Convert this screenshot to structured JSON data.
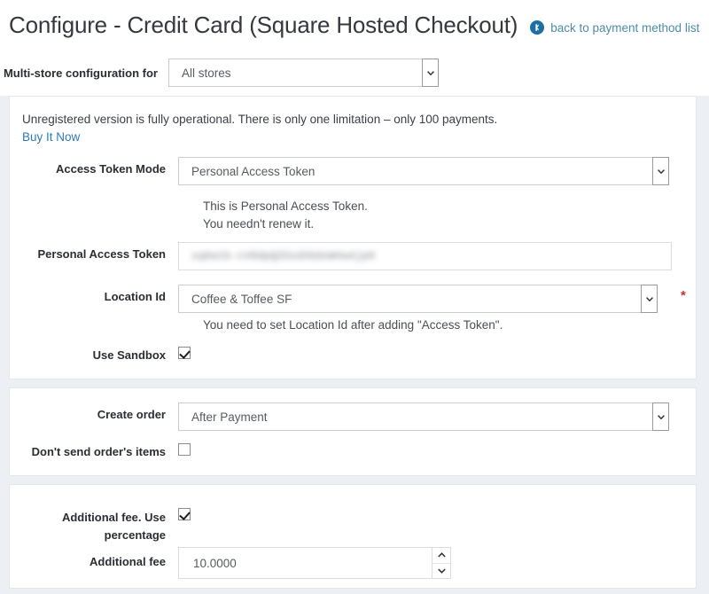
{
  "header": {
    "title": "Configure - Credit Card (Square Hosted Checkout)",
    "back_link": "back to payment method list",
    "back_icon": "circle-back-arrow-icon",
    "link_color": "#4d8da4"
  },
  "multistore": {
    "label": "Multi-store configuration for",
    "value": "All stores"
  },
  "panel_credentials": {
    "notice": "Unregistered version is fully operational. There is only one limitation – only 100 payments.",
    "buy_link": "Buy It Now",
    "access_token_mode": {
      "label": "Access Token Mode",
      "value": "Personal Access Token",
      "help_line_1": "This is Personal Access Token.",
      "help_line_2": "You needn't renew it."
    },
    "personal_access_token": {
      "label": "Personal Access Token",
      "value": "sq0atb-cV8dpQZOxdXGdoWVw4jp0"
    },
    "location_id": {
      "label": "Location Id",
      "value": "Coffee & Toffee SF",
      "required_marker": "*",
      "help": "You need to set Location Id after adding \"Access Token\"."
    },
    "use_sandbox": {
      "label": "Use Sandbox",
      "checked": true
    }
  },
  "panel_order": {
    "create_order": {
      "label": "Create order",
      "value": "After Payment"
    },
    "dont_send_items": {
      "label": "Don't send order's items",
      "checked": false
    }
  },
  "panel_fee": {
    "use_percentage": {
      "label": "Additional fee. Use percentage",
      "checked": true
    },
    "additional_fee": {
      "label": "Additional fee",
      "value": "10.0000",
      "spinner_up_icon": "chevron-up-icon",
      "spinner_down_icon": "chevron-down-icon"
    }
  }
}
